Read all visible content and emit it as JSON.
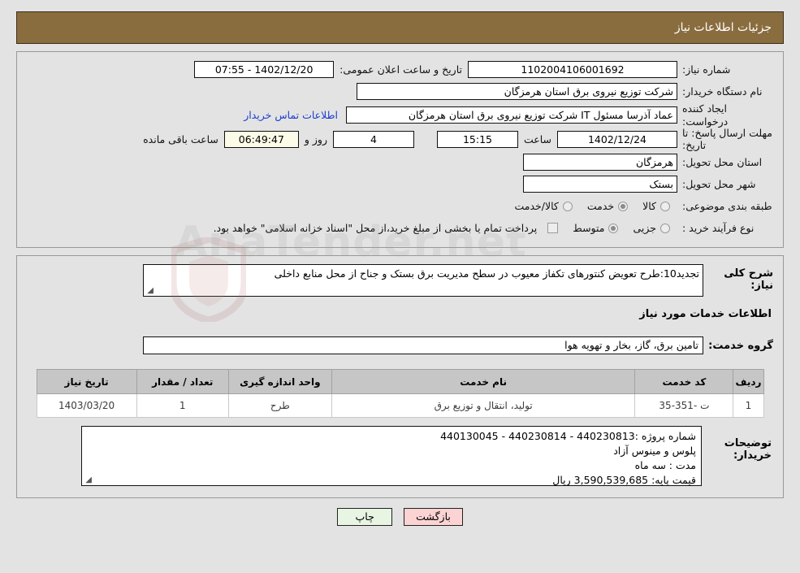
{
  "header": {
    "title": "جزئیات اطلاعات نیاز"
  },
  "form": {
    "need_number": {
      "label": "شماره نیاز:",
      "value": "1102004106001692"
    },
    "announce": {
      "label": "تاریخ و ساعت اعلان عمومی:",
      "value": "1402/12/20 - 07:55"
    },
    "buyer_org": {
      "label": "نام دستگاه خریدار:",
      "value": "شرکت توزیع نیروی برق استان هرمزگان"
    },
    "creator": {
      "label": "ایجاد کننده درخواست:",
      "value": "عماد آذرسا مسئول IT شرکت توزیع نیروی برق استان هرمزگان"
    },
    "contact_link": "اطلاعات تماس خریدار",
    "deadline": {
      "label": "مهلت ارسال پاسخ: تا تاریخ:",
      "date": "1402/12/24",
      "time_label": "ساعت",
      "time": "15:15",
      "days": "4",
      "days_label": "روز و",
      "countdown": "06:49:47",
      "remaining_label": "ساعت باقی مانده"
    },
    "province": {
      "label": "استان محل تحویل:",
      "value": "هرمزگان"
    },
    "city": {
      "label": "شهر محل تحویل:",
      "value": "بستک"
    },
    "category": {
      "label": "طبقه بندی موضوعی:",
      "options": [
        {
          "label": "کالا",
          "selected": false
        },
        {
          "label": "خدمت",
          "selected": true
        },
        {
          "label": "کالا/خدمت",
          "selected": false
        }
      ]
    },
    "process": {
      "label": "نوع فرآیند خرید :",
      "options": [
        {
          "label": "جزیی",
          "selected": false
        },
        {
          "label": "متوسط",
          "selected": true
        }
      ],
      "treasury_checkbox_label": "پرداخت تمام یا بخشی از مبلغ خرید،از محل \"اسناد خزانه اسلامی\" خواهد بود.",
      "treasury_checked": false
    }
  },
  "middle": {
    "desc_label": "شرح کلی نیاز:",
    "desc_value": "تجدید10:طرح تعویض کنتورهای تکفاز معیوب در سطح مدیریت برق بستک و جناح از محل منابع داخلی",
    "section_heading": "اطلاعات خدمات مورد نیاز",
    "group_label": "گروه خدمت:",
    "group_value": "تامین برق، گاز، بخار و تهویه هوا"
  },
  "table": {
    "headers": [
      "ردیف",
      "کد خدمت",
      "نام خدمت",
      "واحد اندازه گیری",
      "تعداد / مقدار",
      "تاریخ نیاز"
    ],
    "rows": [
      {
        "radif": "1",
        "code": "ت -351-35",
        "name": "تولید، انتقال و توزیع برق",
        "unit": "طرح",
        "qty": "1",
        "date": "1403/03/20"
      }
    ]
  },
  "notes": {
    "label": "توضیحات خریدار:",
    "lines": [
      "شماره پروژه :440230813  -  440230814  - 440130045",
      "پلوس و مینوس آزاد",
      "مدت :  سه ماه",
      "قیمت پایه:   3,590,539,685  ریال"
    ]
  },
  "buttons": {
    "back": "بازگشت",
    "print": "چاپ"
  },
  "watermark": {
    "text": "AnaTender.net"
  },
  "colors": {
    "header_bg": "#8a6d3f",
    "page_bg": "#e3e3e3",
    "link": "#1b3fd0",
    "countdown_bg": "#fbfbe7",
    "back_btn": "#fcd3d3",
    "print_btn": "#e7f5e2",
    "table_header_bg": "#c6c6c6"
  }
}
